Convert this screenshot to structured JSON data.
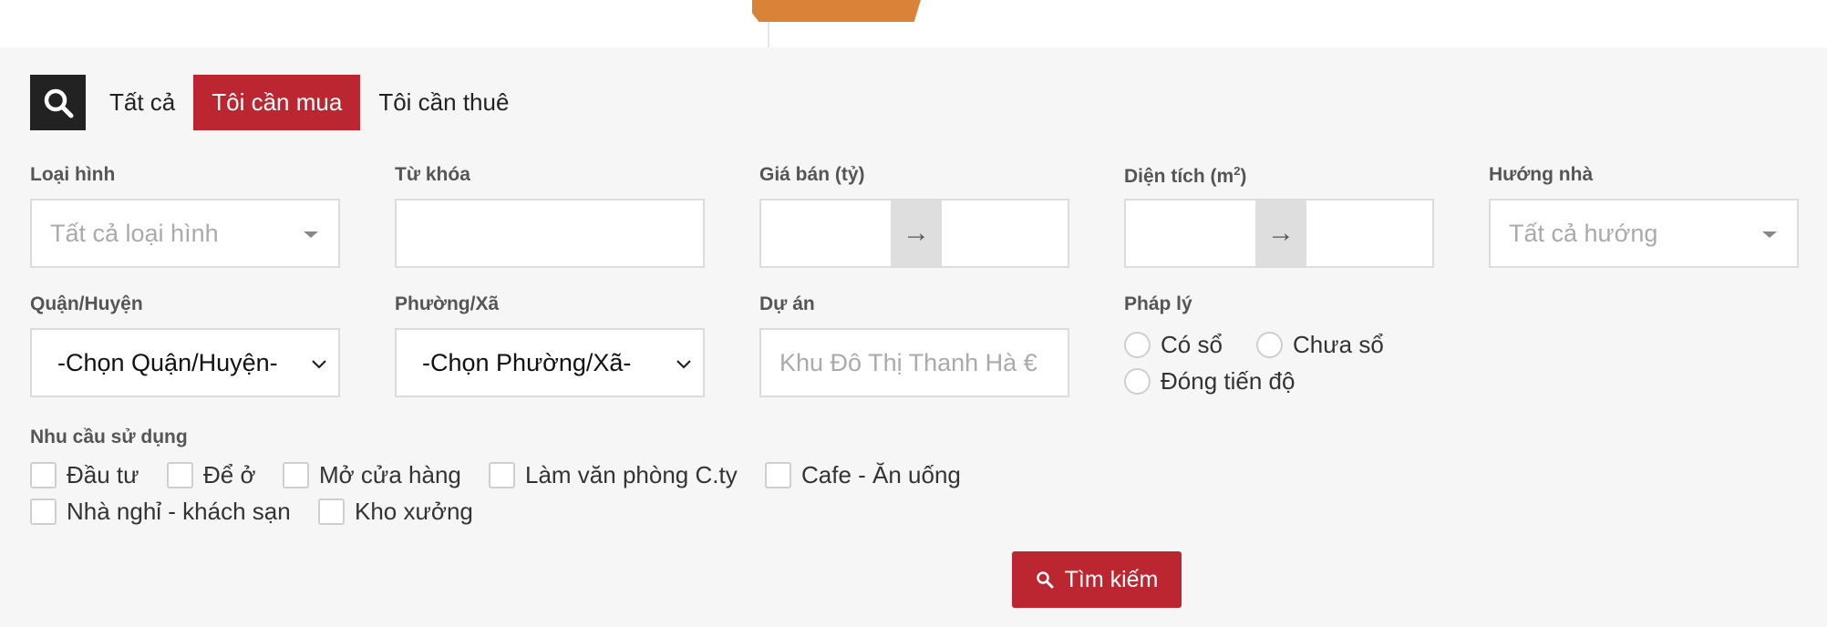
{
  "tabs": {
    "all": "Tất cả",
    "buy": "Tôi cần mua",
    "rent": "Tôi cần thuê"
  },
  "filters": {
    "type": {
      "label": "Loại hình",
      "placeholder": "Tất cả loại hình"
    },
    "keyword": {
      "label": "Từ khóa",
      "value": ""
    },
    "price": {
      "label": "Giá bán (tỷ)",
      "arrow": "→"
    },
    "area": {
      "label_main": "Diện tích (m",
      "label_sup": "2",
      "label_end": ")",
      "arrow": "→"
    },
    "direction": {
      "label": "Hướng nhà",
      "placeholder": "Tất cả hướng"
    },
    "district": {
      "label": "Quận/Huyện",
      "selected": "-Chọn Quận/Huyện-"
    },
    "ward": {
      "label": "Phường/Xã",
      "selected": "-Chọn Phường/Xã-"
    },
    "project": {
      "label": "Dự án",
      "placeholder": "Khu Đô Thị Thanh Hà €"
    },
    "legal": {
      "label": "Pháp lý",
      "options": [
        "Có sổ",
        "Chưa sổ",
        "Đóng tiến độ"
      ]
    },
    "usage": {
      "label": "Nhu cầu sử dụng",
      "options": [
        "Đầu tư",
        "Để ở",
        "Mở cửa hàng",
        "Làm văn phòng C.ty",
        "Cafe - Ăn uống",
        "Nhà nghỉ - khách sạn",
        "Kho xưởng"
      ]
    }
  },
  "search_button": {
    "label": "Tìm kiếm"
  },
  "colors": {
    "accent": "#bc2631",
    "panel_bg": "#f6f6f6",
    "orange": "#d98338"
  }
}
